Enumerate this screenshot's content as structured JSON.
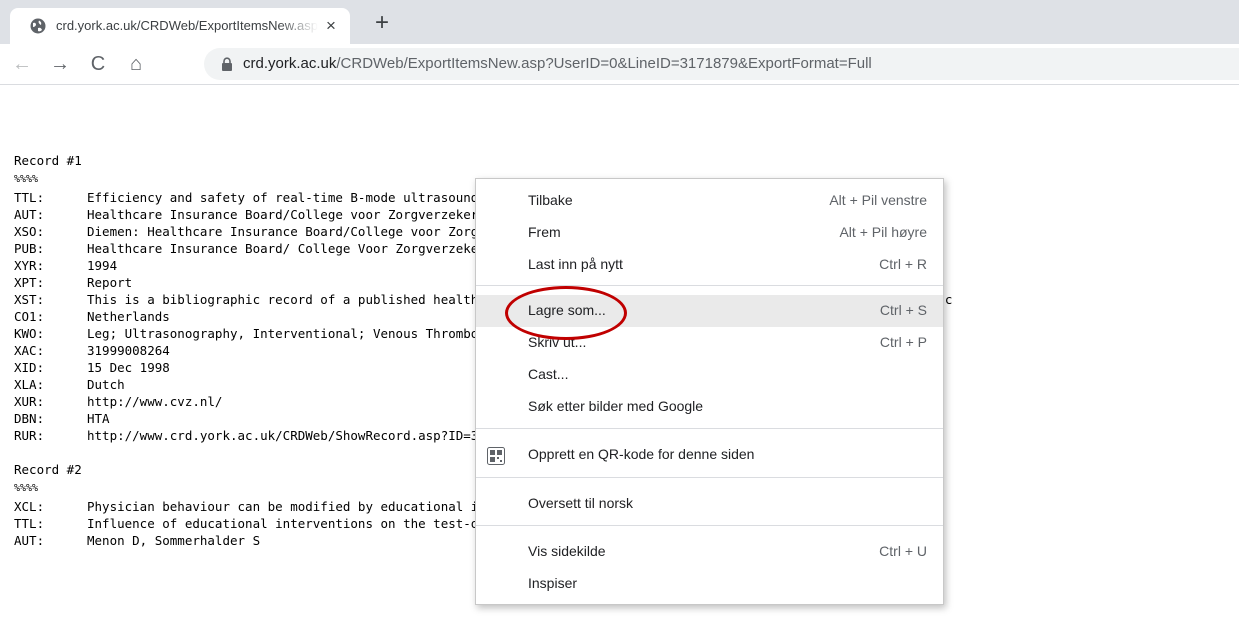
{
  "tab": {
    "title": "crd.york.ac.uk/CRDWeb/ExportItemsNew.asp",
    "close": "×",
    "new_tab": "+"
  },
  "toolbar": {
    "back": "←",
    "forward": "→",
    "reload": "C",
    "home": "⌂",
    "url_host": "crd.york.ac.uk",
    "url_path": "/CRDWeb/ExportItemsNew.asp?UserID=0&LineID=3171879&ExportFormat=Full"
  },
  "icons": {
    "favicon": "globe-icon",
    "lock": "lock-icon",
    "qr": "qr-code-icon"
  },
  "colors": {
    "highlight_ellipse": "#c00000",
    "menu_hover": "#eaeaea",
    "tabstrip": "#dee1e6"
  },
  "records": [
    {
      "header": "Record #1",
      "marker": "%%%%",
      "fields": [
        {
          "tag": "TTL:",
          "value": "Efficiency and safety of real-time B-mode ultrasound in the diagnosis of deep venous thrombosis in the leg - pri"
        },
        {
          "tag": "AUT:",
          "value": "Healthcare Insurance Board/College voor Zorgverzekeringen"
        },
        {
          "tag": "XSO:",
          "value": "Diemen: Healthcare Insurance Board/College voor Zorgverzekeringen"
        },
        {
          "tag": "PUB:",
          "value": "Healthcare Insurance Board/ College Voor Zorgverzekeringen"
        },
        {
          "tag": "XYR:",
          "value": "1994"
        },
        {
          "tag": "XPT:",
          "value": "Report"
        },
        {
          "tag": "XST:",
          "value": "This is a bibliographic record of a published health technology assessment from a member of INAHTA. No evaluation c"
        },
        {
          "tag": "CO1:",
          "value": "Netherlands"
        },
        {
          "tag": "KWO:",
          "value": "Leg; Ultrasonography, Interventional; Venous Thrombosis"
        },
        {
          "tag": "XAC:",
          "value": "31999008264"
        },
        {
          "tag": "XID:",
          "value": "15 Dec 1998"
        },
        {
          "tag": "XLA:",
          "value": "Dutch"
        },
        {
          "tag": "XUR:",
          "value": "http://www.cvz.nl/"
        },
        {
          "tag": "DBN:",
          "value": "HTA"
        },
        {
          "tag": "RUR:",
          "value": "http://www.crd.york.ac.uk/CRDWeb/ShowRecord.asp?ID=31999008264"
        }
      ]
    },
    {
      "header": "Record #2",
      "marker": "%%%%",
      "fields": [
        {
          "tag": "XCL:",
          "value": "Physician behaviour can be modified by educational interventions, and the effects are better and last longer th"
        },
        {
          "tag": "TTL:",
          "value": "Influence of educational interventions on the test-ordering patterns of physicians"
        },
        {
          "tag": "AUT:",
          "value": "Menon D, Sommerhalder S"
        }
      ]
    }
  ],
  "context_menu": {
    "items": [
      {
        "label": "Tilbake",
        "shortcut": "Alt + Pil venstre"
      },
      {
        "label": "Frem",
        "shortcut": "Alt + Pil høyre"
      },
      {
        "label": "Last inn på nytt",
        "shortcut": "Ctrl + R"
      },
      {
        "label": "Lagre som...",
        "shortcut": "Ctrl + S"
      },
      {
        "label": "Skriv ut...",
        "shortcut": "Ctrl + P"
      },
      {
        "label": "Cast...",
        "shortcut": ""
      },
      {
        "label": "Søk etter bilder med Google",
        "shortcut": ""
      },
      {
        "label": "Opprett en QR-kode for denne siden",
        "shortcut": ""
      },
      {
        "label": "Oversett til norsk",
        "shortcut": ""
      },
      {
        "label": "Vis sidekilde",
        "shortcut": "Ctrl + U"
      },
      {
        "label": "Inspiser",
        "shortcut": ""
      }
    ]
  }
}
